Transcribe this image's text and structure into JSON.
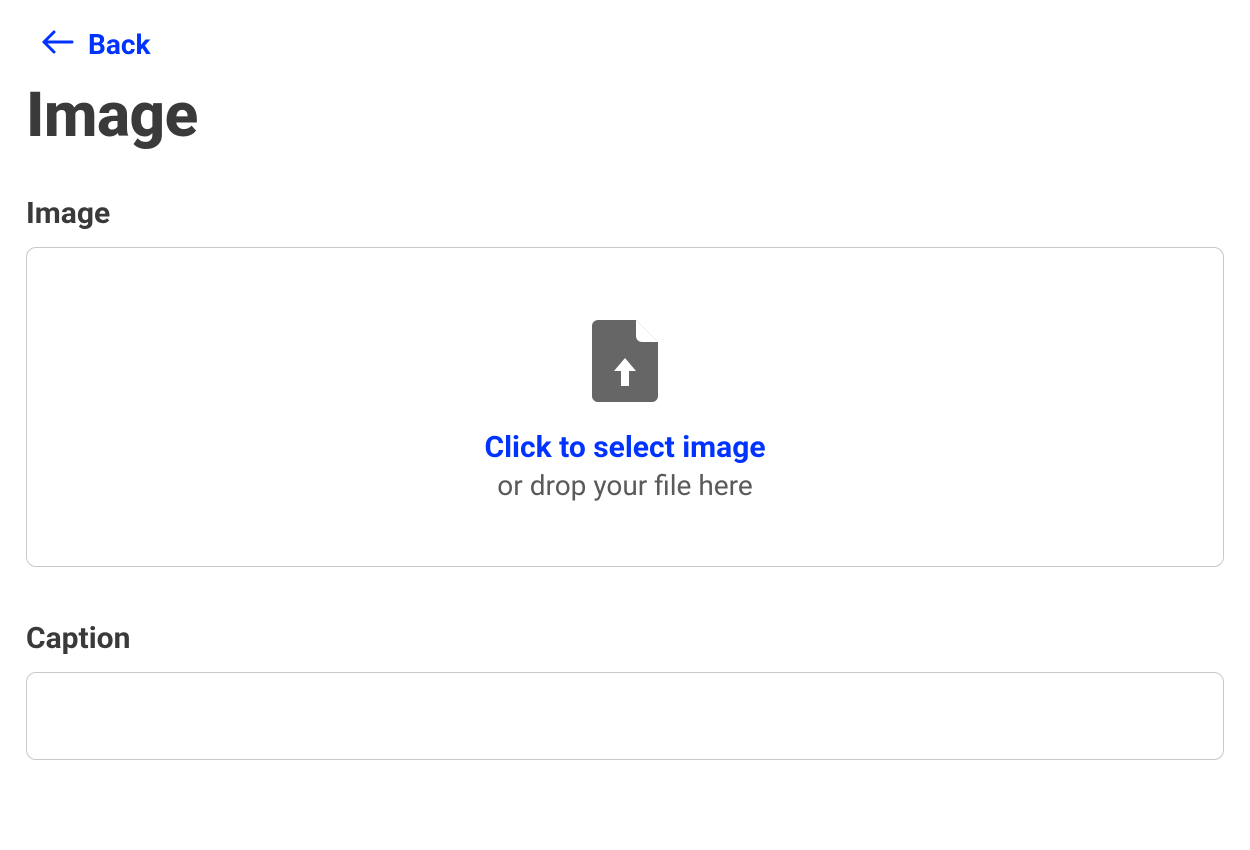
{
  "nav": {
    "back_label": "Back"
  },
  "page": {
    "title": "Image"
  },
  "fields": {
    "image": {
      "label": "Image",
      "click_text": "Click to select image",
      "drop_text": "or drop your file here"
    },
    "caption": {
      "label": "Caption",
      "value": ""
    }
  }
}
